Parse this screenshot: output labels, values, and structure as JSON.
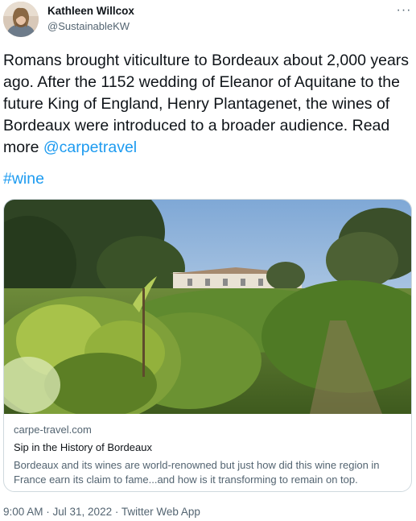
{
  "author": {
    "name": "Kathleen Willcox",
    "handle": "@SustainableKW"
  },
  "more_icon": "more-horizontal-icon",
  "tweet": {
    "text_main": "Romans brought viticulture to Bordeaux about 2,000 years ago. After the 1152 wedding of Eleanor of Aquitane to the future King of England, Henry Plantagenet, the wines of Bordeaux were introduced to a broader audience. Read more ",
    "mention": "@carpetravel",
    "hashtag": "#wine"
  },
  "card": {
    "domain": "carpe-travel.com",
    "title": "Sip in the History of Bordeaux",
    "description": "Bordeaux and its wines are world-renowned but just how did this wine region in France earn its claim to fame...and how is it transforming to remain on top."
  },
  "meta": {
    "timestamp": "9:00 AM · Jul 31, 2022 · Twitter Web App"
  },
  "colors": {
    "accent": "#1d9bf0",
    "text": "#0f1419",
    "secondary": "#536471",
    "border": "#cfd9de"
  }
}
